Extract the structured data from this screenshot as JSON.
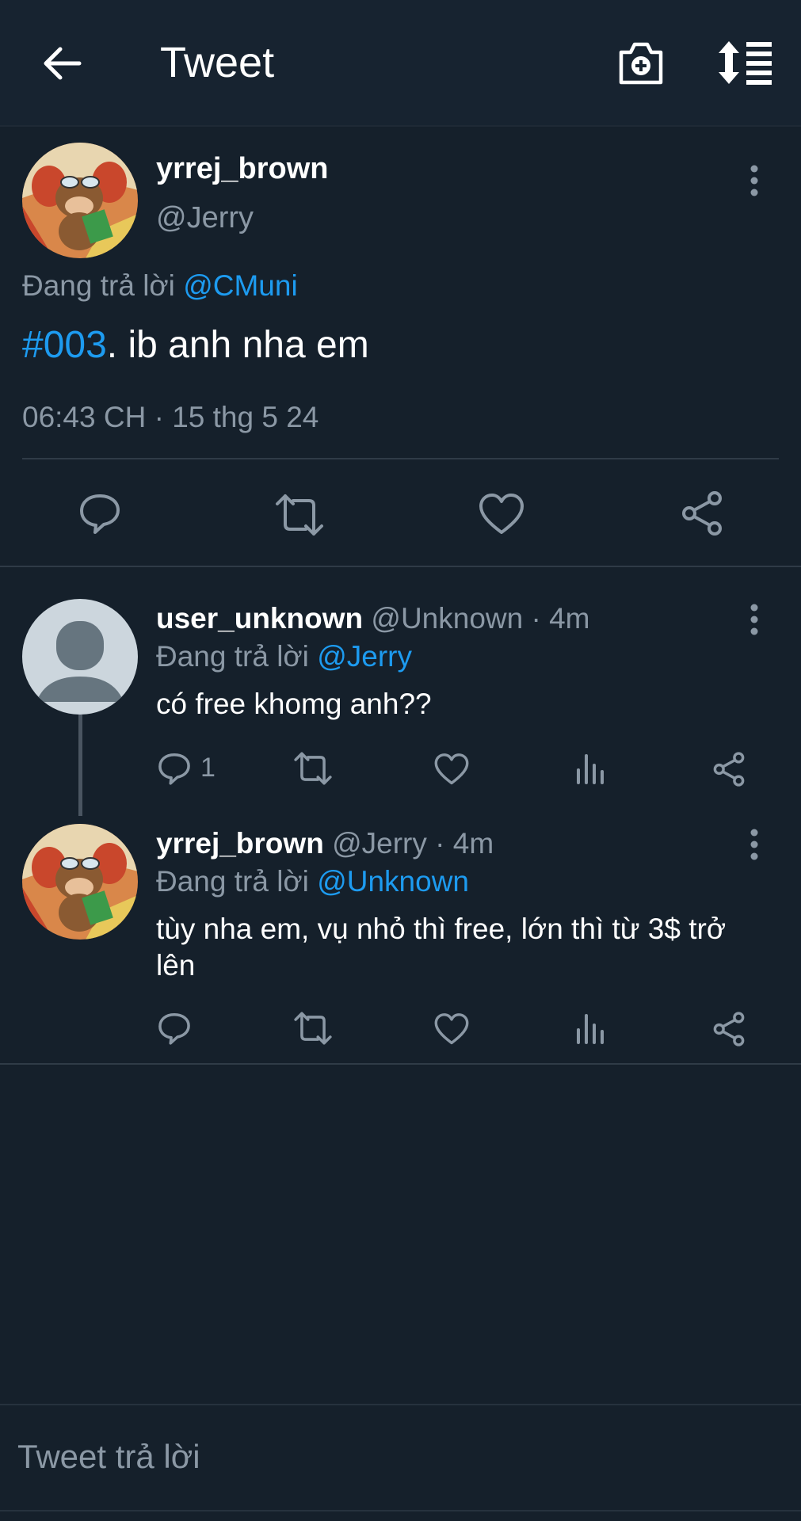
{
  "header": {
    "title": "Tweet",
    "back_icon": "arrow-left-icon",
    "camera_icon": "camera-plus-icon",
    "sort_icon": "sort-list-icon"
  },
  "main_tweet": {
    "display_name": "yrrej_brown",
    "handle": "@Jerry",
    "replying_prefix": "Đang trả lời",
    "replying_to": "@CMuni",
    "hashtag": "#003",
    "body": ". ib anh nha em",
    "timestamp": "06:43 CH · 15 thg 5 24"
  },
  "replies": [
    {
      "display_name": "user_unknown",
      "handle_time": "@Unknown · 4m",
      "replying_prefix": "Đang trả lời",
      "replying_to": "@Jerry",
      "body": "có free khomg anh??",
      "reply_count": "1"
    },
    {
      "display_name": "yrrej_brown",
      "handle_time": "@Jerry · 4m",
      "replying_prefix": "Đang trả lời",
      "replying_to": "@Unknown",
      "body_line1": "tùy nha em, vụ nhỏ thì free, lớn thì từ 3$ trở",
      "body_line2": "lên"
    }
  ],
  "reply_box": {
    "placeholder": "Tweet trả lời"
  },
  "colors": {
    "background": "#15202b",
    "accent": "#1d9bf0",
    "muted": "#8b98a5"
  }
}
